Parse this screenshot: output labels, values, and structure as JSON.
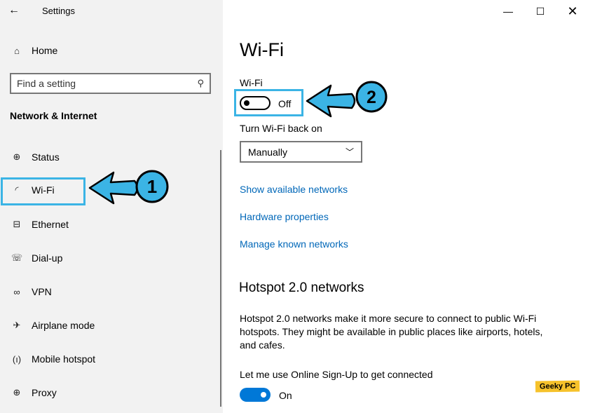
{
  "window": {
    "title": "Settings",
    "back_icon": "arrow-left-icon",
    "minimize_icon": "minimize-icon",
    "maximize_icon": "maximize-icon",
    "close_icon": "close-icon"
  },
  "sidebar": {
    "home": "Home",
    "search_placeholder": "Find a setting",
    "section": "Network & Internet",
    "items": [
      {
        "label": "Status",
        "icon": "globe-monitor-icon",
        "glyph": "⊕"
      },
      {
        "label": "Wi-Fi",
        "icon": "wifi-icon",
        "glyph": "◜"
      },
      {
        "label": "Ethernet",
        "icon": "ethernet-icon",
        "glyph": "⊟"
      },
      {
        "label": "Dial-up",
        "icon": "phone-icon",
        "glyph": "☏"
      },
      {
        "label": "VPN",
        "icon": "vpn-icon",
        "glyph": "∞"
      },
      {
        "label": "Airplane mode",
        "icon": "airplane-icon",
        "glyph": "✈"
      },
      {
        "label": "Mobile hotspot",
        "icon": "hotspot-icon",
        "glyph": "(ı)"
      },
      {
        "label": "Proxy",
        "icon": "globe-icon",
        "glyph": "⊕"
      }
    ]
  },
  "main": {
    "title": "Wi-Fi",
    "wifi_label": "Wi-Fi",
    "wifi_state": "Off",
    "turn_back_label": "Turn Wi-Fi back on",
    "turn_back_value": "Manually",
    "links": [
      "Show available networks",
      "Hardware properties",
      "Manage known networks"
    ],
    "hotspot_heading": "Hotspot 2.0 networks",
    "hotspot_desc": "Hotspot 2.0 networks make it more secure to connect to public Wi-Fi hotspots. They might be available in public places like airports, hotels, and cafes.",
    "signup_label": "Let me use Online Sign-Up to get connected",
    "signup_state": "On"
  },
  "annotations": {
    "step1": "1",
    "step2": "2",
    "color": "#3bb4e5"
  },
  "watermark": "Geeky PC",
  "colors": {
    "accent": "#0078d7",
    "link": "#0067b8",
    "sidebar_bg": "#f2f2f2"
  }
}
